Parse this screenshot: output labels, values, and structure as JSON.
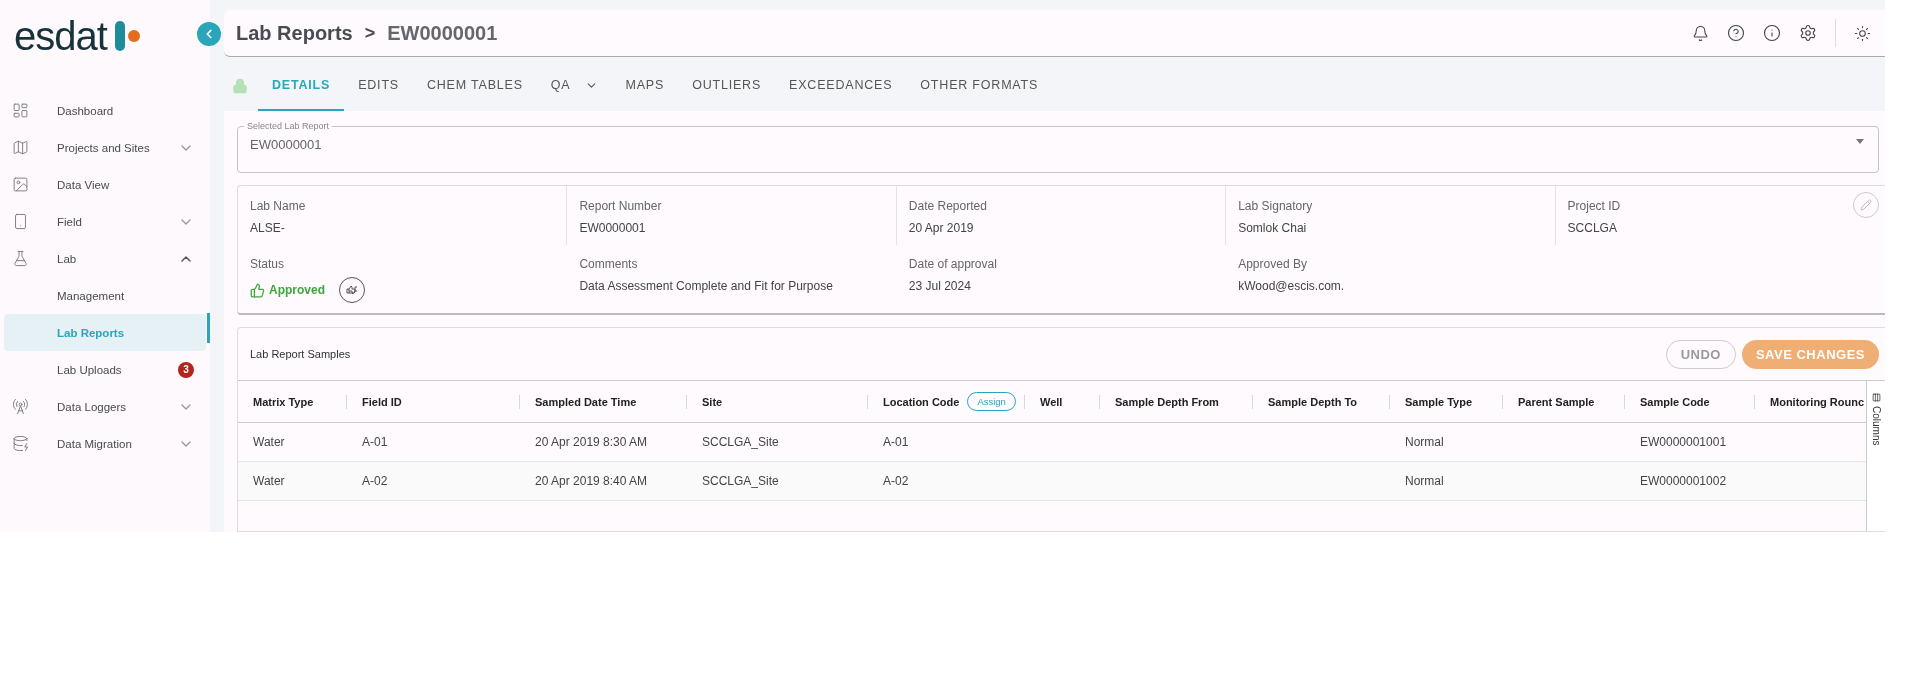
{
  "logo": {
    "text": "esdat"
  },
  "sidebar": {
    "items": [
      {
        "label": "Dashboard",
        "selected": false
      },
      {
        "label": "Projects and Sites",
        "expanded": false,
        "selected": false
      },
      {
        "label": "Data View",
        "selected": false
      },
      {
        "label": "Field",
        "expanded": false,
        "selected": false
      },
      {
        "label": "Lab",
        "expanded": true,
        "selected": false,
        "children": [
          {
            "label": "Management",
            "selected": false
          },
          {
            "label": "Lab Reports",
            "selected": true
          },
          {
            "label": "Lab Uploads",
            "selected": false,
            "badge": "3"
          }
        ]
      },
      {
        "label": "Data Loggers",
        "expanded": false,
        "selected": false
      },
      {
        "label": "Data Migration",
        "expanded": false,
        "selected": false
      }
    ]
  },
  "header": {
    "title": "Lab Reports",
    "separator": ">",
    "subtitle": "EW0000001"
  },
  "tabs": [
    {
      "label": "DETAILS",
      "selected": true,
      "has_menu": false
    },
    {
      "label": "EDITS",
      "selected": false,
      "has_menu": false
    },
    {
      "label": "CHEM TABLES",
      "selected": false,
      "has_menu": false
    },
    {
      "label": "QA",
      "selected": false,
      "has_menu": true
    },
    {
      "label": "MAPS",
      "selected": false,
      "has_menu": false
    },
    {
      "label": "OUTLIERS",
      "selected": false,
      "has_menu": false
    },
    {
      "label": "EXCEEDANCES",
      "selected": false,
      "has_menu": false
    },
    {
      "label": "OTHER FORMATS",
      "selected": false,
      "has_menu": false
    }
  ],
  "selected_report": {
    "label": "Selected Lab Report",
    "value": "EW0000001"
  },
  "details": [
    {
      "label": "Lab Name",
      "value": "ALSE-",
      "kind": "text"
    },
    {
      "label": "Report Number",
      "value": "EW0000001",
      "kind": "text"
    },
    {
      "label": "Date Reported",
      "value": "20 Apr 2019",
      "kind": "text"
    },
    {
      "label": "Lab Signatory",
      "value": "Somlok Chai",
      "kind": "text"
    },
    {
      "label": "Project ID",
      "value": "SCCLGA",
      "kind": "text"
    },
    {
      "label": "Status",
      "value": "Approved",
      "kind": "status"
    },
    {
      "label": "Comments",
      "value": "Data Assessment Complete and Fit for Purpose",
      "kind": "text"
    },
    {
      "label": "Date of approval",
      "value": "23 Jul 2024",
      "kind": "text"
    },
    {
      "label": "Approved By",
      "value": "kWood@escis.com.",
      "kind": "text"
    }
  ],
  "samples": {
    "title": "Lab Report Samples",
    "buttons": [
      {
        "label": "UNDO",
        "kind": "outline",
        "disabled": true
      },
      {
        "label": "SAVE CHANGES",
        "kind": "filled",
        "disabled": false
      }
    ],
    "side_tab": "Columns",
    "columns": [
      {
        "label": "Matrix Type"
      },
      {
        "label": "Field ID"
      },
      {
        "label": "Sampled Date Time"
      },
      {
        "label": "Site"
      },
      {
        "label": "Location Code",
        "action": "Assign"
      },
      {
        "label": "Well"
      },
      {
        "label": "Sample Depth From"
      },
      {
        "label": "Sample Depth To"
      },
      {
        "label": "Sample Type"
      },
      {
        "label": "Parent Sample"
      },
      {
        "label": "Sample Code"
      },
      {
        "label": "Monitoring Rounc"
      }
    ],
    "rows": [
      [
        "Water",
        "A-01",
        "20 Apr 2019 8:30 AM",
        "SCCLGA_Site",
        "A-01",
        "",
        "",
        "",
        "Normal",
        "",
        "EW0000001001",
        ""
      ],
      [
        "Water",
        "A-02",
        "20 Apr 2019 8:40 AM",
        "SCCLGA_Site",
        "A-02",
        "",
        "",
        "",
        "Normal",
        "",
        "EW0000001002",
        ""
      ]
    ]
  }
}
